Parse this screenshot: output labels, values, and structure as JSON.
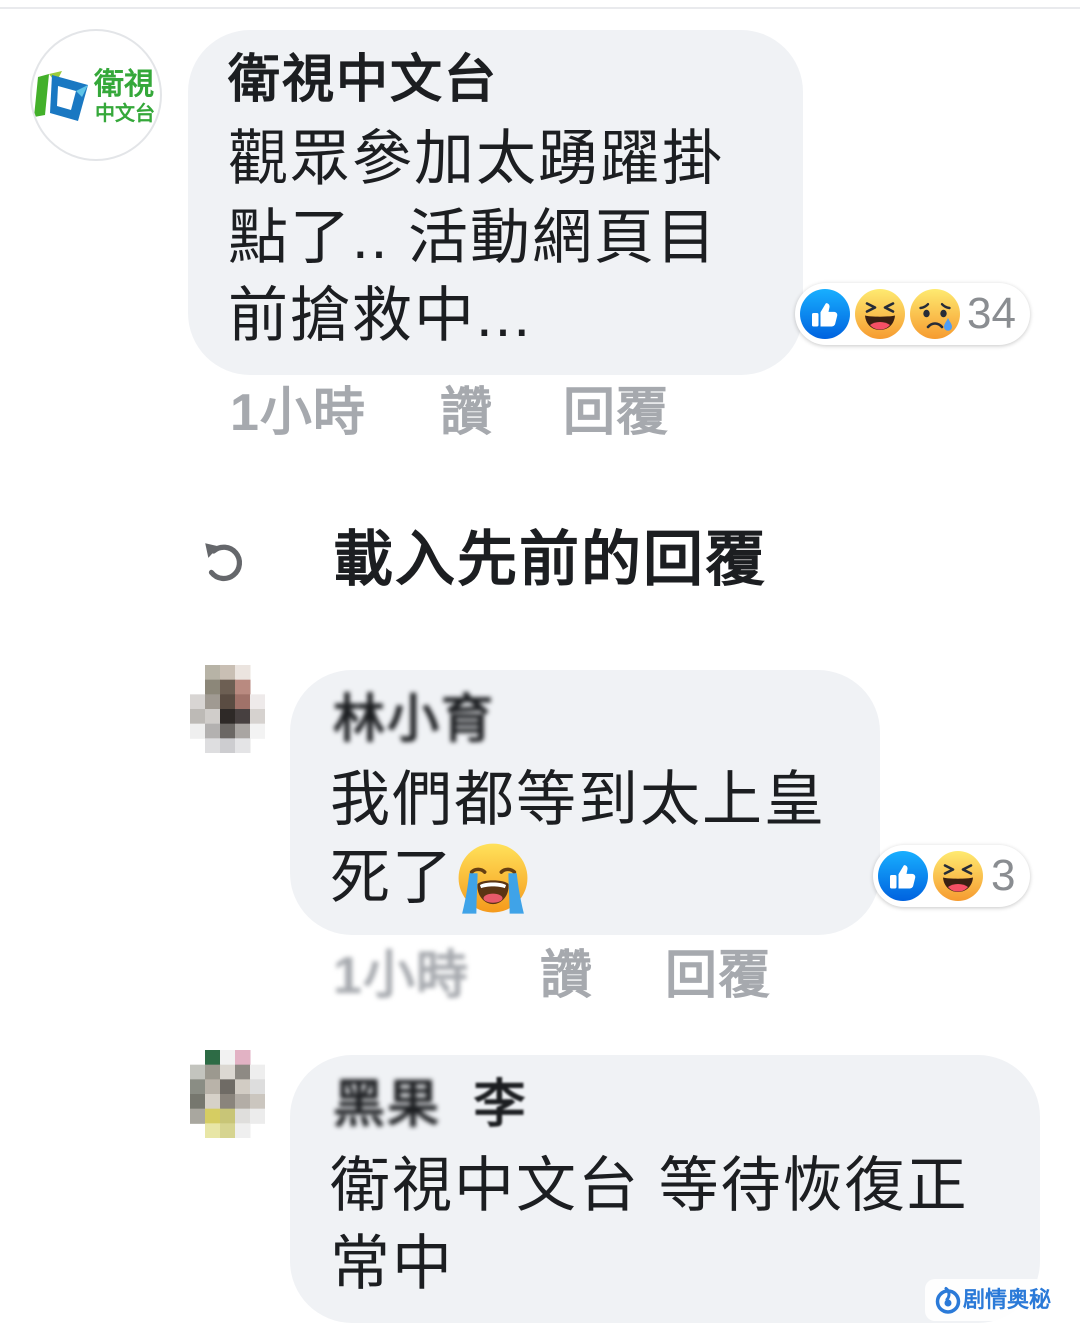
{
  "logo": {
    "line1": "衛視",
    "line2": "中文台"
  },
  "load_previous": {
    "label": "載入先前的回覆",
    "icon": "reload-icon"
  },
  "comments": [
    {
      "author": "衛視中文台",
      "lines": [
        "觀眾參加太踴躍掛",
        "點了.. 活動網頁目",
        "前搶救中..."
      ],
      "reactions": {
        "icons": [
          "like-icon",
          "haha-icon",
          "sad-icon"
        ],
        "count": "34"
      },
      "time": "1小時",
      "like_label": "讚",
      "reply_label": "回覆"
    },
    {
      "author": "林小育",
      "lines": [
        "我們都等到太上皇",
        "死了"
      ],
      "trailing_emoji": "loudly-crying-face-icon",
      "reactions": {
        "icons": [
          "like-icon",
          "haha-icon"
        ],
        "count": "3"
      },
      "time": "1小時",
      "like_label": "讚",
      "reply_label": "回覆"
    },
    {
      "author_parts": [
        "黑果",
        "李"
      ],
      "lines": [
        "衛視中文台 等待恢復正",
        "常中"
      ]
    }
  ],
  "watermark": {
    "text": "剧情奥秘",
    "icon": "swirl-logo-icon"
  },
  "colors": {
    "bubble": "#f0f2f5",
    "text": "#1c1e21",
    "meta_gray": "#a6a9ae",
    "like_blue": "#1877f2",
    "watermark_blue": "#2b7ad8"
  }
}
